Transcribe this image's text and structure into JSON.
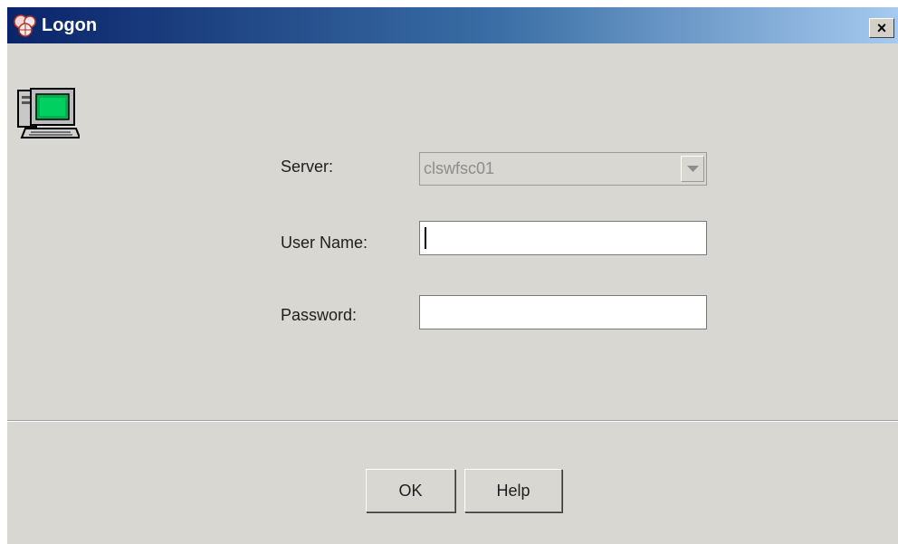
{
  "window": {
    "title": "Logon",
    "close_glyph": "×",
    "title_icon": "logon-app-icon"
  },
  "branding": {
    "icon": "computer-terminal-icon"
  },
  "form": {
    "server": {
      "label": "Server:",
      "value": "clswfsc01",
      "disabled": true
    },
    "user_name": {
      "label": "User Name:",
      "value": ""
    },
    "password": {
      "label": "Password:",
      "value": ""
    }
  },
  "buttons": {
    "ok_label": "OK",
    "help_label": "Help"
  },
  "colors": {
    "titlebar_start": "#0a246a",
    "titlebar_end": "#a6caf0",
    "dialog_bg": "#d8d7d2",
    "disabled_text": "#8d8d8d"
  }
}
